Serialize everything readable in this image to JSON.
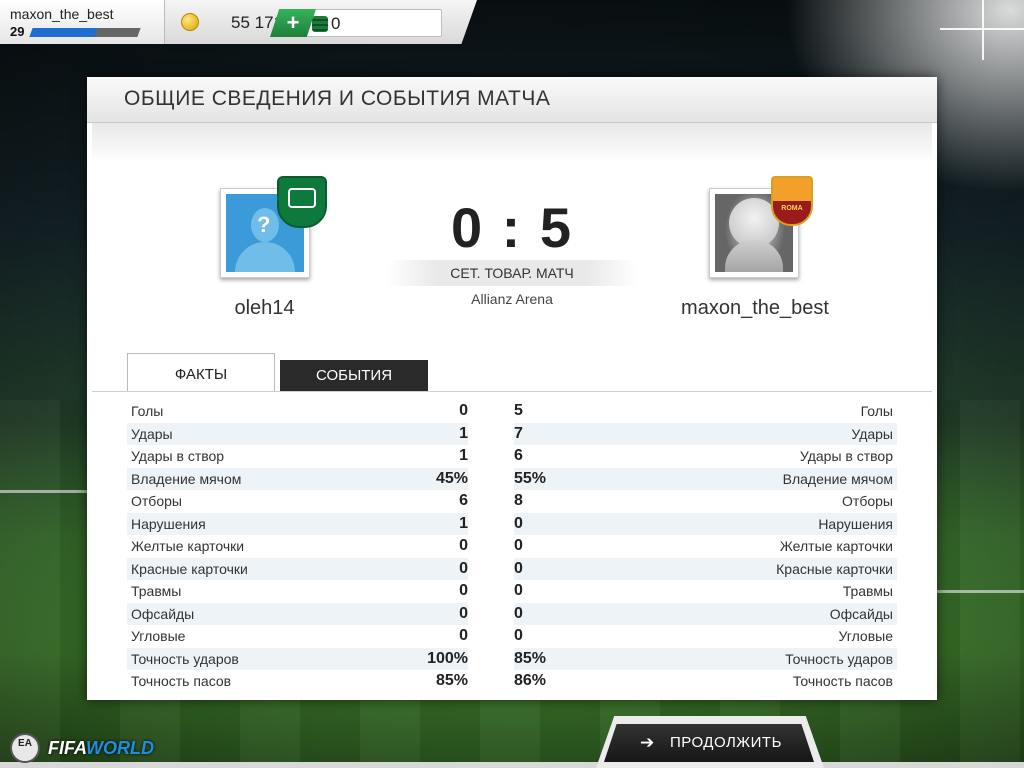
{
  "topbar": {
    "username": "maxon_the_best",
    "level": "29",
    "xp_progress_percent": 60,
    "coins": "55 171",
    "points": "0",
    "add_icon": "+"
  },
  "panel": {
    "title": "ОБЩИЕ СВЕДЕНИЯ И СОБЫТИЯ МАТЧА"
  },
  "match": {
    "home_team": "oleh14",
    "away_team": "maxon_the_best",
    "score": "0 : 5",
    "match_type": "СЕТ. ТОВАР. МАТЧ",
    "venue": "Allianz Arena",
    "home_avatar_question_mark": "?",
    "away_crest_text": "ROMA"
  },
  "tabs": {
    "facts": "ФАКТЫ",
    "events": "СОБЫТИЯ"
  },
  "stats": [
    {
      "label": "Голы",
      "home": "0",
      "away": "5"
    },
    {
      "label": "Удары",
      "home": "1",
      "away": "7"
    },
    {
      "label": "Удары в створ",
      "home": "1",
      "away": "6"
    },
    {
      "label": "Владение мячом",
      "home": "45%",
      "away": "55%"
    },
    {
      "label": "Отборы",
      "home": "6",
      "away": "8"
    },
    {
      "label": "Нарушения",
      "home": "1",
      "away": "0"
    },
    {
      "label": "Желтые карточки",
      "home": "0",
      "away": "0"
    },
    {
      "label": "Красные карточки",
      "home": "0",
      "away": "0"
    },
    {
      "label": "Травмы",
      "home": "0",
      "away": "0"
    },
    {
      "label": "Офсайды",
      "home": "0",
      "away": "0"
    },
    {
      "label": "Угловые",
      "home": "0",
      "away": "0"
    },
    {
      "label": "Точность ударов",
      "home": "100%",
      "away": "85%"
    },
    {
      "label": "Точность пасов",
      "home": "85%",
      "away": "86%"
    }
  ],
  "footer": {
    "continue_label": "ПРОДОЛЖИТЬ",
    "continue_icon": "arrow-right-icon",
    "logo_ea": "EA",
    "logo_fifa": "FIFA",
    "logo_world": "WORLD"
  },
  "colors": {
    "accent_green": "#1e7f3a",
    "xp_blue": "#1f6fd1",
    "dark_button": "#222222"
  }
}
